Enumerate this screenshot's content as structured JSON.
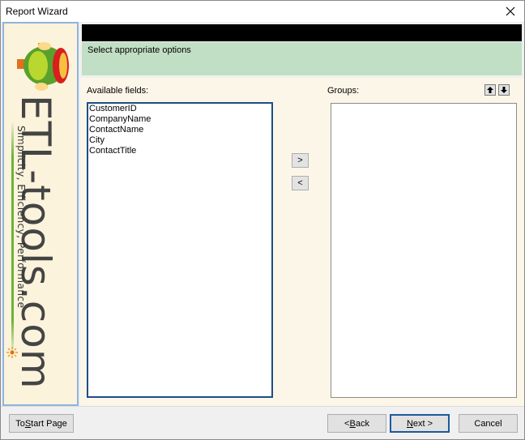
{
  "window": {
    "title": "Report Wizard"
  },
  "banner": {
    "brand": "ETL-tools.com",
    "tagline": "Simplicity, Efficiency, Performance"
  },
  "header": {
    "subtitle": "Select appropriate options"
  },
  "available": {
    "label": "Available fields:",
    "items": [
      "CustomerID",
      "CompanyName",
      "ContactName",
      "City",
      "ContactTitle"
    ]
  },
  "groups": {
    "label": "Groups:",
    "items": []
  },
  "transfer": {
    "add_label": ">",
    "remove_label": "<"
  },
  "footer": {
    "start_prefix": "To ",
    "start_mnemonic": "S",
    "start_suffix": "tart Page",
    "back_prefix": "< ",
    "back_mnemonic": "B",
    "back_suffix": "ack",
    "next_mnemonic": "N",
    "next_suffix": "ext >",
    "cancel_label": "Cancel"
  },
  "icons": [
    "close-icon",
    "move-up-icon",
    "move-down-icon",
    "logo-icon",
    "flower-icon"
  ]
}
